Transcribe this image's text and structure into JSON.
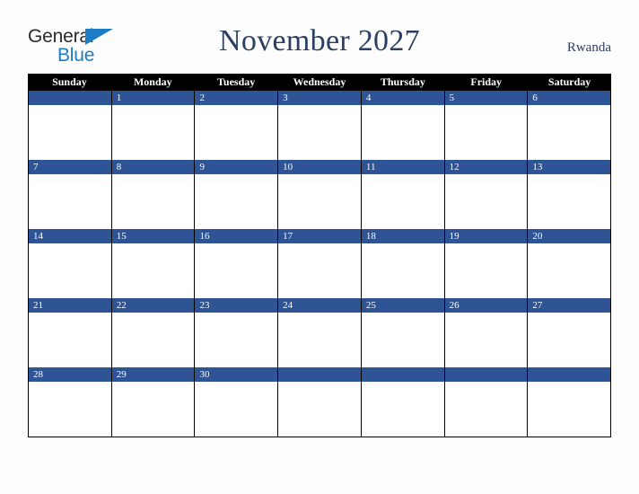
{
  "brand": {
    "name_part1": "General",
    "name_part2": "Blue",
    "triangle_icon": "triangle-icon",
    "color_dark": "#2b2b2b",
    "color_blue": "#1c7cc4"
  },
  "header": {
    "title": "November 2027",
    "country": "Rwanda",
    "title_color": "#2b3f63"
  },
  "calendar": {
    "month": "November",
    "year": "2027",
    "accent_color": "#2e5496",
    "header_bg": "#000000",
    "header_text_color": "#ffffff",
    "weekday_headers": [
      "Sunday",
      "Monday",
      "Tuesday",
      "Wednesday",
      "Thursday",
      "Friday",
      "Saturday"
    ],
    "weeks": [
      [
        "",
        "1",
        "2",
        "3",
        "4",
        "5",
        "6"
      ],
      [
        "7",
        "8",
        "9",
        "10",
        "11",
        "12",
        "13"
      ],
      [
        "14",
        "15",
        "16",
        "17",
        "18",
        "19",
        "20"
      ],
      [
        "21",
        "22",
        "23",
        "24",
        "25",
        "26",
        "27"
      ],
      [
        "28",
        "29",
        "30",
        "",
        "",
        "",
        ""
      ]
    ]
  }
}
